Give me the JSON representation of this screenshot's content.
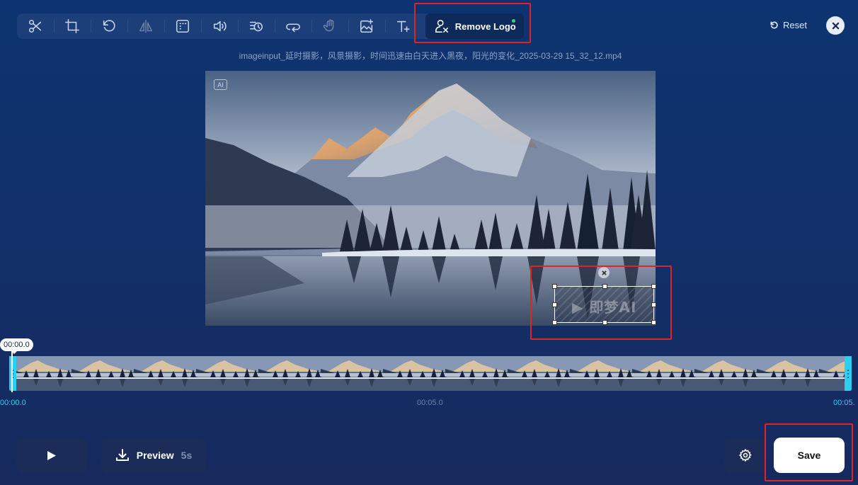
{
  "toolbar": {
    "tools": [
      {
        "icon": "scissors-icon",
        "label": "Cut"
      },
      {
        "icon": "crop-icon",
        "label": "Crop"
      },
      {
        "icon": "rotate-icon",
        "label": "Rotate"
      },
      {
        "icon": "flip-icon",
        "label": "Flip"
      },
      {
        "icon": "resize-icon",
        "label": "Resize"
      },
      {
        "icon": "volume-icon",
        "label": "Volume"
      },
      {
        "icon": "speed-icon",
        "label": "Speed"
      },
      {
        "icon": "loop-icon",
        "label": "Loop"
      },
      {
        "icon": "stabilize-icon",
        "label": "Stabilize"
      },
      {
        "icon": "image-add-icon",
        "label": "Add Image"
      },
      {
        "icon": "text-add-icon",
        "label": "Add Text"
      }
    ],
    "active_tool_label": "Remove Logo"
  },
  "header": {
    "reset_label": "Reset"
  },
  "video": {
    "filename": "imageinput_延时摄影，风景摄影，时间迅速由白天进入黑夜，阳光的变化_2025-03-29 15_32_12.mp4",
    "ai_badge": "AI"
  },
  "timeline": {
    "current_time": "00:00.0",
    "start_label": "00:00.0",
    "mid_label": "00:05.0",
    "end_label": "00:05."
  },
  "controls": {
    "preview_label": "Preview",
    "preview_duration": "5s",
    "save_label": "Save"
  },
  "colors": {
    "background_top": "#0d3470",
    "background_bottom": "#172a5e",
    "accent_cyan": "#2ad1ef",
    "highlight_red": "#e02424",
    "active_dot": "#31d27a"
  }
}
